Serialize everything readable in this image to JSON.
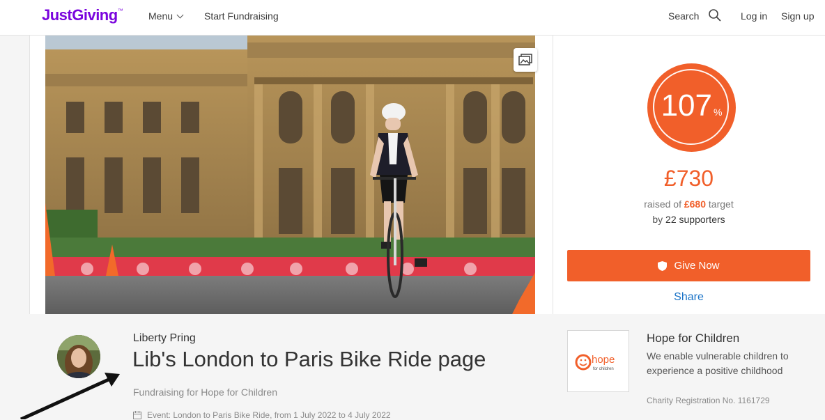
{
  "header": {
    "logo": "JustGiving",
    "logo_tm": "™",
    "menu_label": "Menu",
    "start_fundraising": "Start Fundraising",
    "search_label": "Search",
    "login": "Log in",
    "signup": "Sign up"
  },
  "progress": {
    "percent": "107",
    "percent_sign": "%",
    "raised": "£730",
    "raised_of": "raised of",
    "target": "£680",
    "target_word": "target",
    "by": "by",
    "supporters": "22 supporters"
  },
  "actions": {
    "give_now": "Give Now",
    "share": "Share"
  },
  "page": {
    "owner": "Liberty Pring",
    "title": "Lib's London to Paris Bike Ride page",
    "fundraising_for": "Fundraising for Hope for Children",
    "event": "Event: London to Paris Bike Ride, from 1 July 2022 to 4 July 2022"
  },
  "charity": {
    "name": "Hope for Children",
    "description": "We enable vulnerable children to experience a positive childhood",
    "registration": "Charity Registration No. 1161729",
    "logo_text": "hope",
    "logo_subtext": "for children"
  },
  "colors": {
    "brand": "#7a04dd",
    "accent": "#f15f2a",
    "link": "#1a73c7"
  },
  "icons": {
    "search": "search-icon",
    "gallery": "image-gallery-icon",
    "shield": "shield-icon",
    "calendar": "calendar-icon"
  }
}
